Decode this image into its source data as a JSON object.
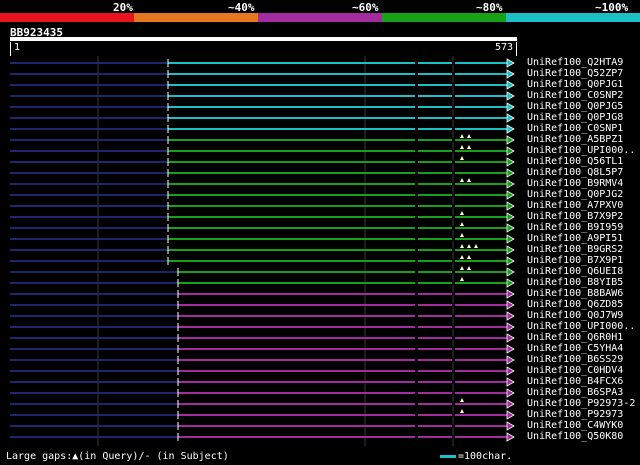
{
  "colors": {
    "red": "#e8141e",
    "orange": "#e6761f",
    "purple": "#a22c9e",
    "green": "#16a116",
    "cyan": "#1bbfc6",
    "gap": "#1d2770"
  },
  "legend": {
    "labels": [
      "20%",
      "~40%",
      "~60%",
      "~80%",
      "~100%"
    ]
  },
  "query": {
    "name": "BB923435",
    "start": "1",
    "end": "573"
  },
  "hits": [
    {
      "id": "UniRef100_Q2HTA9",
      "color": "cyan",
      "markers": 0
    },
    {
      "id": "UniRef100_Q52ZP7",
      "color": "cyan",
      "markers": 0
    },
    {
      "id": "UniRef100_Q0PJG1",
      "color": "cyan",
      "markers": 0
    },
    {
      "id": "UniRef100_C0SNP2",
      "color": "cyan",
      "markers": 0
    },
    {
      "id": "UniRef100_Q0PJG5",
      "color": "cyan",
      "markers": 0
    },
    {
      "id": "UniRef100_Q0PJG8",
      "color": "cyan",
      "markers": 0
    },
    {
      "id": "UniRef100_C0SNP1",
      "color": "cyan",
      "markers": 0
    },
    {
      "id": "UniRef100_A5BPZ1",
      "color": "green",
      "markers": 2
    },
    {
      "id": "UniRef100_UPI000..",
      "color": "green",
      "markers": 2
    },
    {
      "id": "UniRef100_Q56TL1",
      "color": "green",
      "markers": 1
    },
    {
      "id": "UniRef100_Q8L5P7",
      "color": "green",
      "markers": 0
    },
    {
      "id": "UniRef100_B9RMV4",
      "color": "green",
      "markers": 2
    },
    {
      "id": "UniRef100_Q0PJG2",
      "color": "green",
      "markers": 0
    },
    {
      "id": "UniRef100_A7PXV0",
      "color": "green",
      "markers": 0
    },
    {
      "id": "UniRef100_B7X9P2",
      "color": "green",
      "markers": 1
    },
    {
      "id": "UniRef100_B9I959",
      "color": "green",
      "markers": 1
    },
    {
      "id": "UniRef100_A9PI51",
      "color": "green",
      "markers": 1
    },
    {
      "id": "UniRef100_B9GRS2",
      "color": "green",
      "markers": 3
    },
    {
      "id": "UniRef100_B7X9P1",
      "color": "green",
      "markers": 2
    },
    {
      "id": "UniRef100_Q6UEI8",
      "color": "green",
      "markers": 2
    },
    {
      "id": "UniRef100_B8YIB5",
      "color": "green",
      "markers": 1
    },
    {
      "id": "UniRef100_B8BAW6",
      "color": "purple",
      "markers": 0
    },
    {
      "id": "UniRef100_Q6ZD85",
      "color": "purple",
      "markers": 0
    },
    {
      "id": "UniRef100_Q0J7W9",
      "color": "purple",
      "markers": 0
    },
    {
      "id": "UniRef100_UPI000..",
      "color": "purple",
      "markers": 0
    },
    {
      "id": "UniRef100_Q6R0H1",
      "color": "purple",
      "markers": 0
    },
    {
      "id": "UniRef100_C5YHA4",
      "color": "purple",
      "markers": 0
    },
    {
      "id": "UniRef100_B6SS29",
      "color": "purple",
      "markers": 0
    },
    {
      "id": "UniRef100_C0HDV4",
      "color": "purple",
      "markers": 0
    },
    {
      "id": "UniRef100_B4FCX6",
      "color": "purple",
      "markers": 0
    },
    {
      "id": "UniRef100_B6SPA3",
      "color": "purple",
      "markers": 0
    },
    {
      "id": "UniRef100_P92973-2",
      "color": "purple",
      "markers": 1
    },
    {
      "id": "UniRef100_P92973",
      "color": "purple",
      "markers": 1
    },
    {
      "id": "UniRef100_C4WYK0",
      "color": "purple",
      "markers": 0
    },
    {
      "id": "UniRef100_Q50K80",
      "color": "purple",
      "markers": 0
    }
  ],
  "footer": {
    "gaps_text": "Large gaps:▲(in Query)/- (in Subject)",
    "scale_text": "=100char."
  }
}
